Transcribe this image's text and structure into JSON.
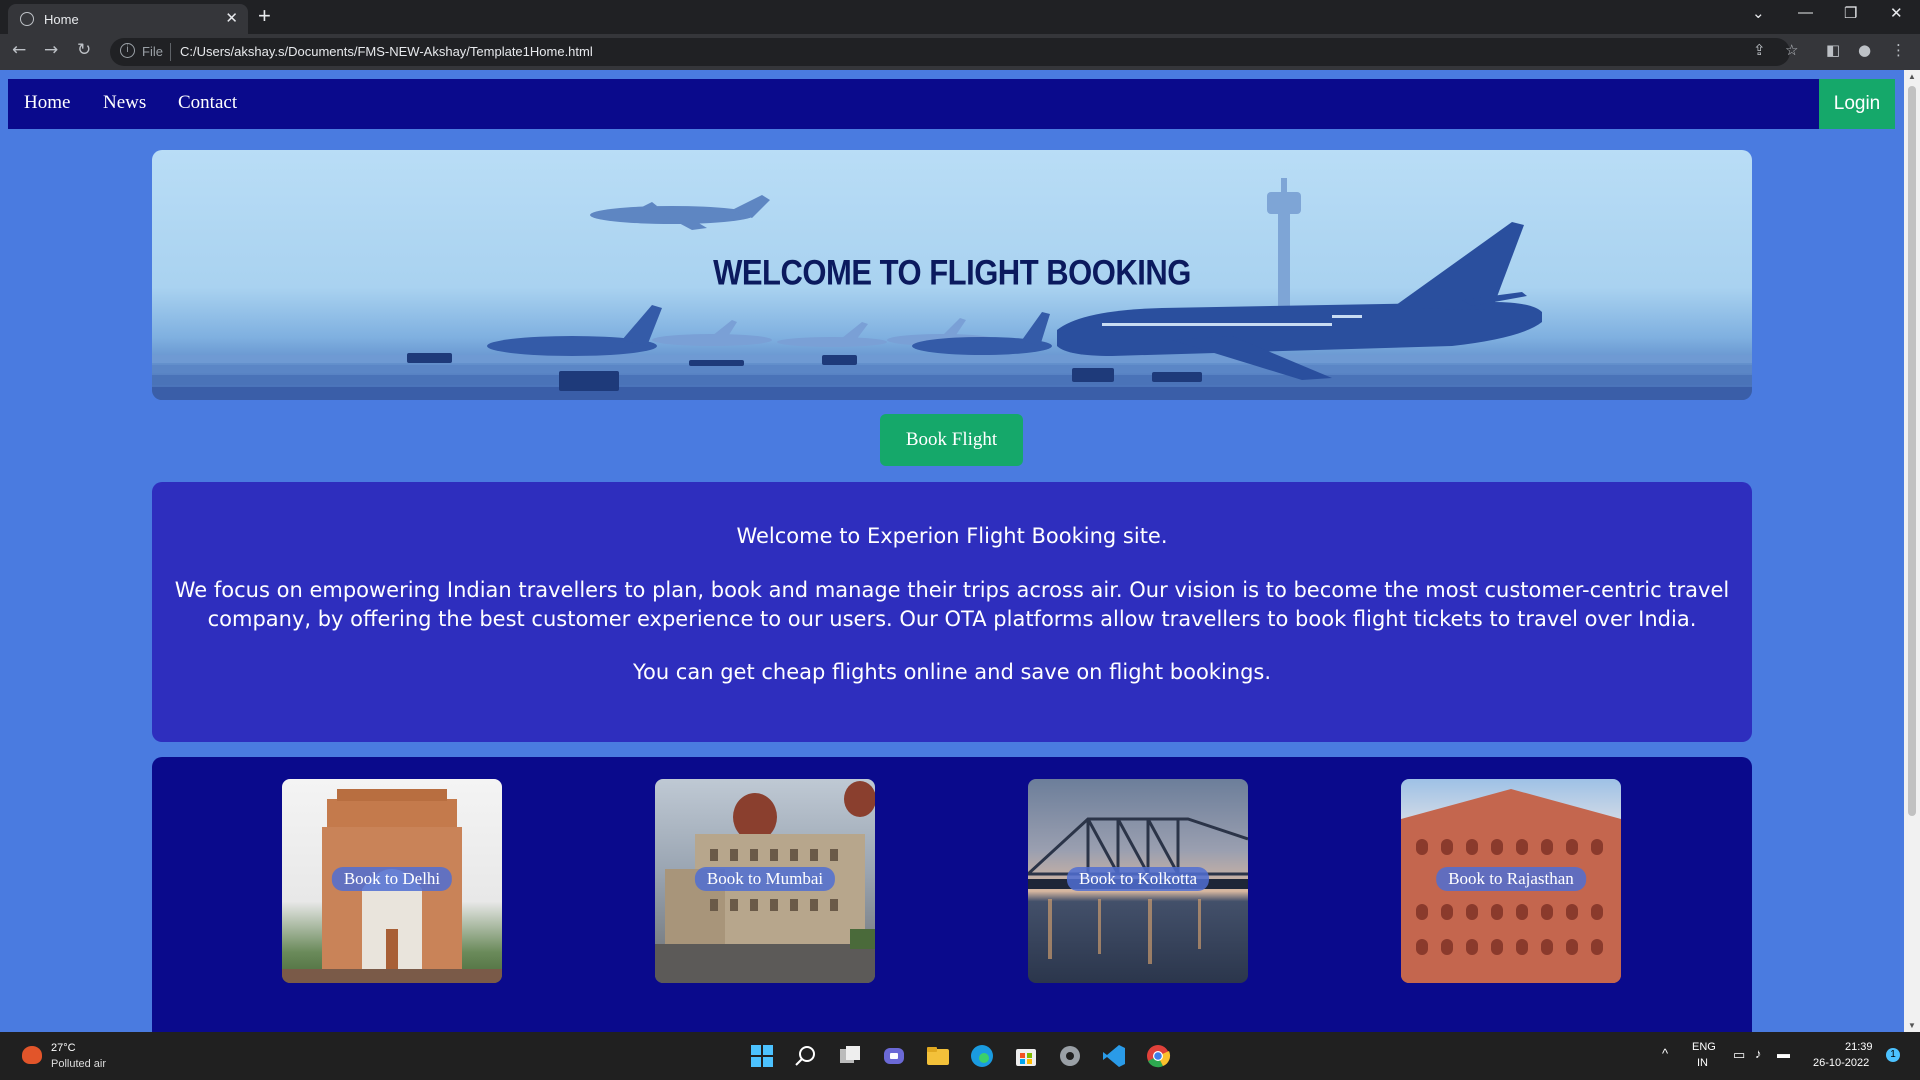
{
  "browser": {
    "tab_title": "Home",
    "new_tab": "+",
    "close": "✕",
    "scheme": "File",
    "url": "C:/Users/akshay.s/Documents/FMS-NEW-Akshay/Template1Home.html",
    "icons": [
      "back-icon",
      "forward-icon",
      "reload-icon",
      "info-icon",
      "share-icon",
      "star-icon",
      "sidepanel-icon",
      "profile-icon",
      "menu-icon"
    ]
  },
  "nav": {
    "links": [
      "Home",
      "News",
      "Contact"
    ],
    "login": "Login"
  },
  "hero": {
    "title": "WELCOME TO FLIGHT BOOKING"
  },
  "book_button": "Book Flight",
  "about": {
    "line1": "Welcome to Experion Flight Booking site.",
    "line2": "We focus on empowering Indian travellers to plan, book and manage their trips across air. Our vision is to become the most customer-centric travel company, by offering the best customer experience to our users. Our OTA platforms allow travellers to book flight tickets to travel over India.",
    "line3": "You can get cheap flights online and save on flight bookings."
  },
  "destinations": [
    {
      "label": "Book to Delhi"
    },
    {
      "label": "Book to Mumbai"
    },
    {
      "label": "Book to Kolkotta"
    },
    {
      "label": "Book to Rajasthan"
    }
  ],
  "taskbar": {
    "temp": "27°C",
    "weather": "Polluted air",
    "lang1": "ENG",
    "lang2": "IN",
    "time": "21:39",
    "date": "26-10-2022",
    "notif": "1"
  },
  "colors": {
    "page_bg": "#4a7be0",
    "nav_bg": "#0a0a8c",
    "accent_green": "#15a86a",
    "about_bg": "#2e2ebe",
    "hero_title": "#0b1a5e"
  }
}
